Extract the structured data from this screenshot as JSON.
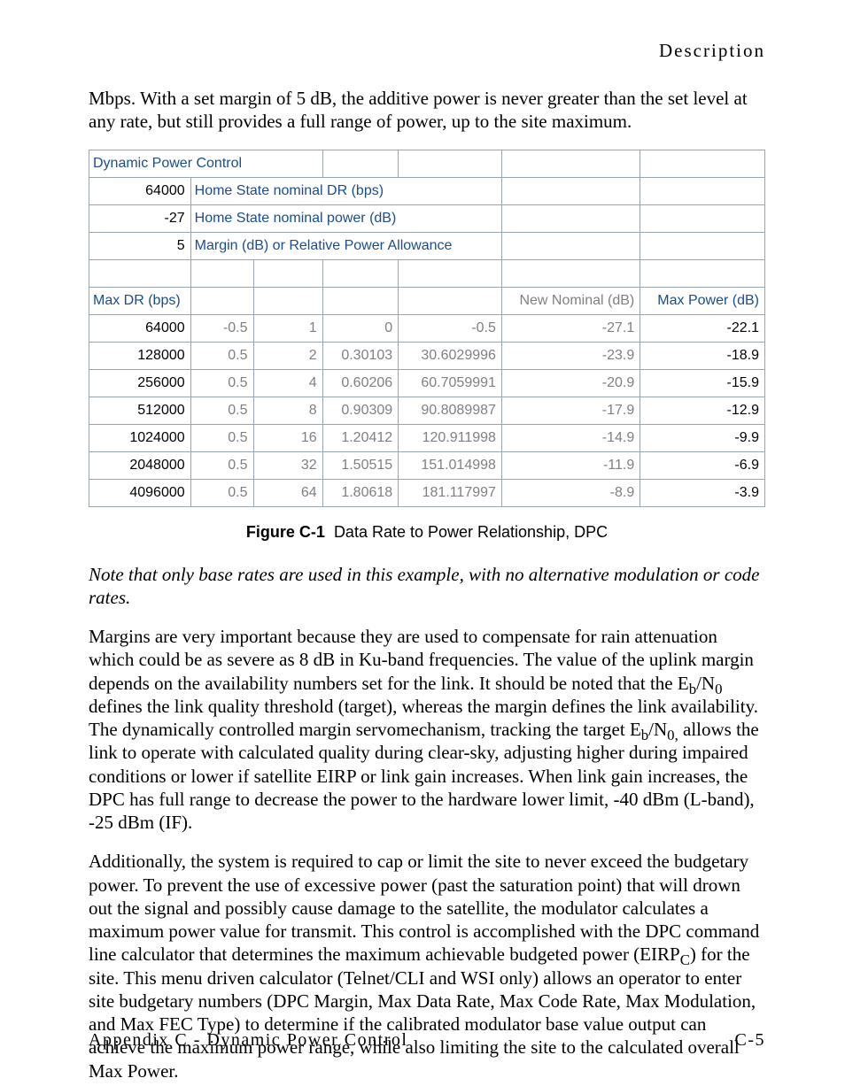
{
  "header": {
    "section": "Description"
  },
  "intro_paragraph": "Mbps. With a set margin of 5 dB, the additive power is never greater than the set level at any rate, but still provides a full range of power, up to the site maximum.",
  "chart_data": {
    "type": "table",
    "title_cell": "Dynamic Power Control",
    "params": [
      {
        "value": "64000",
        "label": "Home State nominal DR (bps)"
      },
      {
        "value": "-27",
        "label": "Home State nominal power (dB)"
      },
      {
        "value": "5",
        "label": "Margin (dB) or Relative Power Allowance"
      }
    ],
    "columns": {
      "c1": "Max DR (bps)",
      "c6": "New Nominal (dB)",
      "c7": "Max Power (dB)"
    },
    "rows": [
      {
        "dr": "64000",
        "a": "-0.5",
        "b": "1",
        "c": "0",
        "d": "-0.5",
        "nom": "-27.1",
        "max": "-22.1"
      },
      {
        "dr": "128000",
        "a": "0.5",
        "b": "2",
        "c": "0.30103",
        "d": "30.6029996",
        "nom": "-23.9",
        "max": "-18.9"
      },
      {
        "dr": "256000",
        "a": "0.5",
        "b": "4",
        "c": "0.60206",
        "d": "60.7059991",
        "nom": "-20.9",
        "max": "-15.9"
      },
      {
        "dr": "512000",
        "a": "0.5",
        "b": "8",
        "c": "0.90309",
        "d": "90.8089987",
        "nom": "-17.9",
        "max": "-12.9"
      },
      {
        "dr": "1024000",
        "a": "0.5",
        "b": "16",
        "c": "1.20412",
        "d": "120.911998",
        "nom": "-14.9",
        "max": "-9.9"
      },
      {
        "dr": "2048000",
        "a": "0.5",
        "b": "32",
        "c": "1.50515",
        "d": "151.014998",
        "nom": "-11.9",
        "max": "-6.9"
      },
      {
        "dr": "4096000",
        "a": "0.5",
        "b": "64",
        "c": "1.80618",
        "d": "181.117997",
        "nom": "-8.9",
        "max": "-3.9"
      }
    ]
  },
  "figure_caption": {
    "label": "Figure C-1",
    "text": "Data Rate to Power Relationship, DPC"
  },
  "note_italic": "Note that only base rates are used in this example, with no alternative modulation or code rates.",
  "para2_parts": {
    "p1": "Margins are very important because they are used to compensate for rain attenuation which could be as severe as 8 dB in Ku-band frequencies. The value of the uplink margin depends on the availability numbers set for the link. It should be noted that the E",
    "sub1": "b",
    "p2": "/N",
    "sub2": "0",
    "p3": " defines the link quality threshold (target), whereas the margin defines the link availability. The dynamically controlled margin servomechanism, tracking the target E",
    "sub3": "b",
    "p4": "/N",
    "sub4": "0,",
    "p5": " allows the link to operate with calculated quality during clear-sky, adjusting higher during impaired conditions or lower if satellite EIRP or link gain increases. When link gain increases, the DPC has full range to decrease the power to the hardware lower limit, -40 dBm (L-band), -25 dBm (IF)."
  },
  "para3_parts": {
    "p1": "Additionally, the system is required to cap or limit the site to never exceed the budgetary power. To prevent the use of excessive power (past the saturation point) that will drown out the signal and possibly cause damage to the satellite, the modulator calculates a maximum power value for transmit. This control is accomplished with the DPC command line calculator that determines the maximum achievable budgeted power (EIRP",
    "sub1": "C",
    "p2": ") for the site. This menu driven calculator (Telnet/CLI and WSI only) allows an operator to enter site budgetary numbers (DPC Margin, Max Data Rate, Max Code Rate, Max Modulation, and Max FEC Type) to determine if the calibrated modulator base value output can achieve the maximum power range, while also limiting the site to the calculated overall Max Power."
  },
  "footer": {
    "left": "Appendix C - Dynamic Power Control",
    "right": "C-5"
  }
}
